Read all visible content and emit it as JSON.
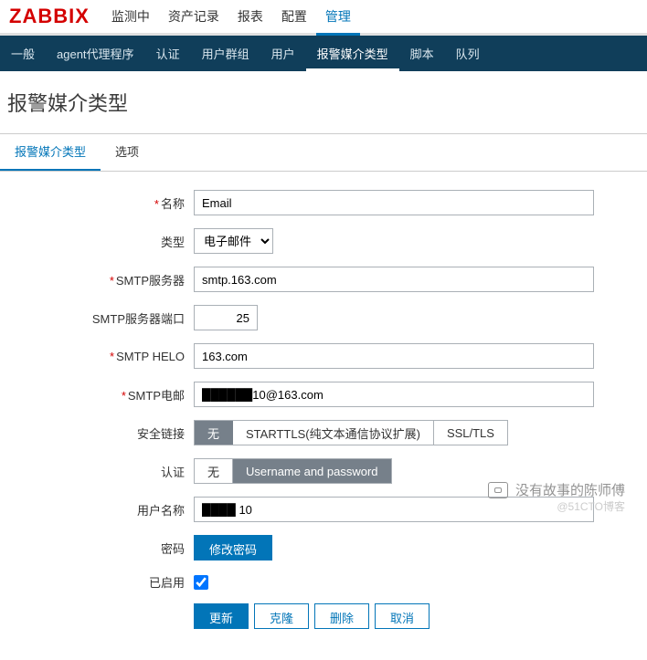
{
  "logo": "ZABBIX",
  "topnav": {
    "items": [
      "监测中",
      "资产记录",
      "报表",
      "配置",
      "管理"
    ],
    "active": 4
  },
  "subnav": {
    "items": [
      "一般",
      "agent代理程序",
      "认证",
      "用户群组",
      "用户",
      "报警媒介类型",
      "脚本",
      "队列"
    ],
    "active": 5
  },
  "page_title": "报警媒介类型",
  "tabs": {
    "items": [
      "报警媒介类型",
      "选项"
    ],
    "active": 0
  },
  "fields": {
    "name": {
      "label": "名称",
      "value": "Email",
      "required": true
    },
    "type": {
      "label": "类型",
      "value": "电子邮件",
      "required": false
    },
    "smtp_server": {
      "label": "SMTP服务器",
      "value": "smtp.163.com",
      "required": true
    },
    "smtp_port": {
      "label": "SMTP服务器端口",
      "value": "25",
      "required": false
    },
    "smtp_helo": {
      "label": "SMTP HELO",
      "value": "163.com",
      "required": true
    },
    "smtp_email": {
      "label": "SMTP电邮",
      "value": "██████10@163.com",
      "required": true
    },
    "conn_sec": {
      "label": "安全链接",
      "options": [
        "无",
        "STARTTLS(纯文本通信协议扩展)",
        "SSL/TLS"
      ],
      "selected": 0
    },
    "auth": {
      "label": "认证",
      "options": [
        "无",
        "Username and password"
      ],
      "selected": 1
    },
    "username": {
      "label": "用户名称",
      "value": "████ 10",
      "required": false
    },
    "password": {
      "label": "密码",
      "button": "修改密码"
    },
    "enabled": {
      "label": "已启用",
      "checked": true
    }
  },
  "buttons": {
    "update": "更新",
    "clone": "克隆",
    "delete": "删除",
    "cancel": "取消"
  },
  "watermark": {
    "text": "没有故事的陈师傅",
    "sub": "@51CTO博客"
  }
}
